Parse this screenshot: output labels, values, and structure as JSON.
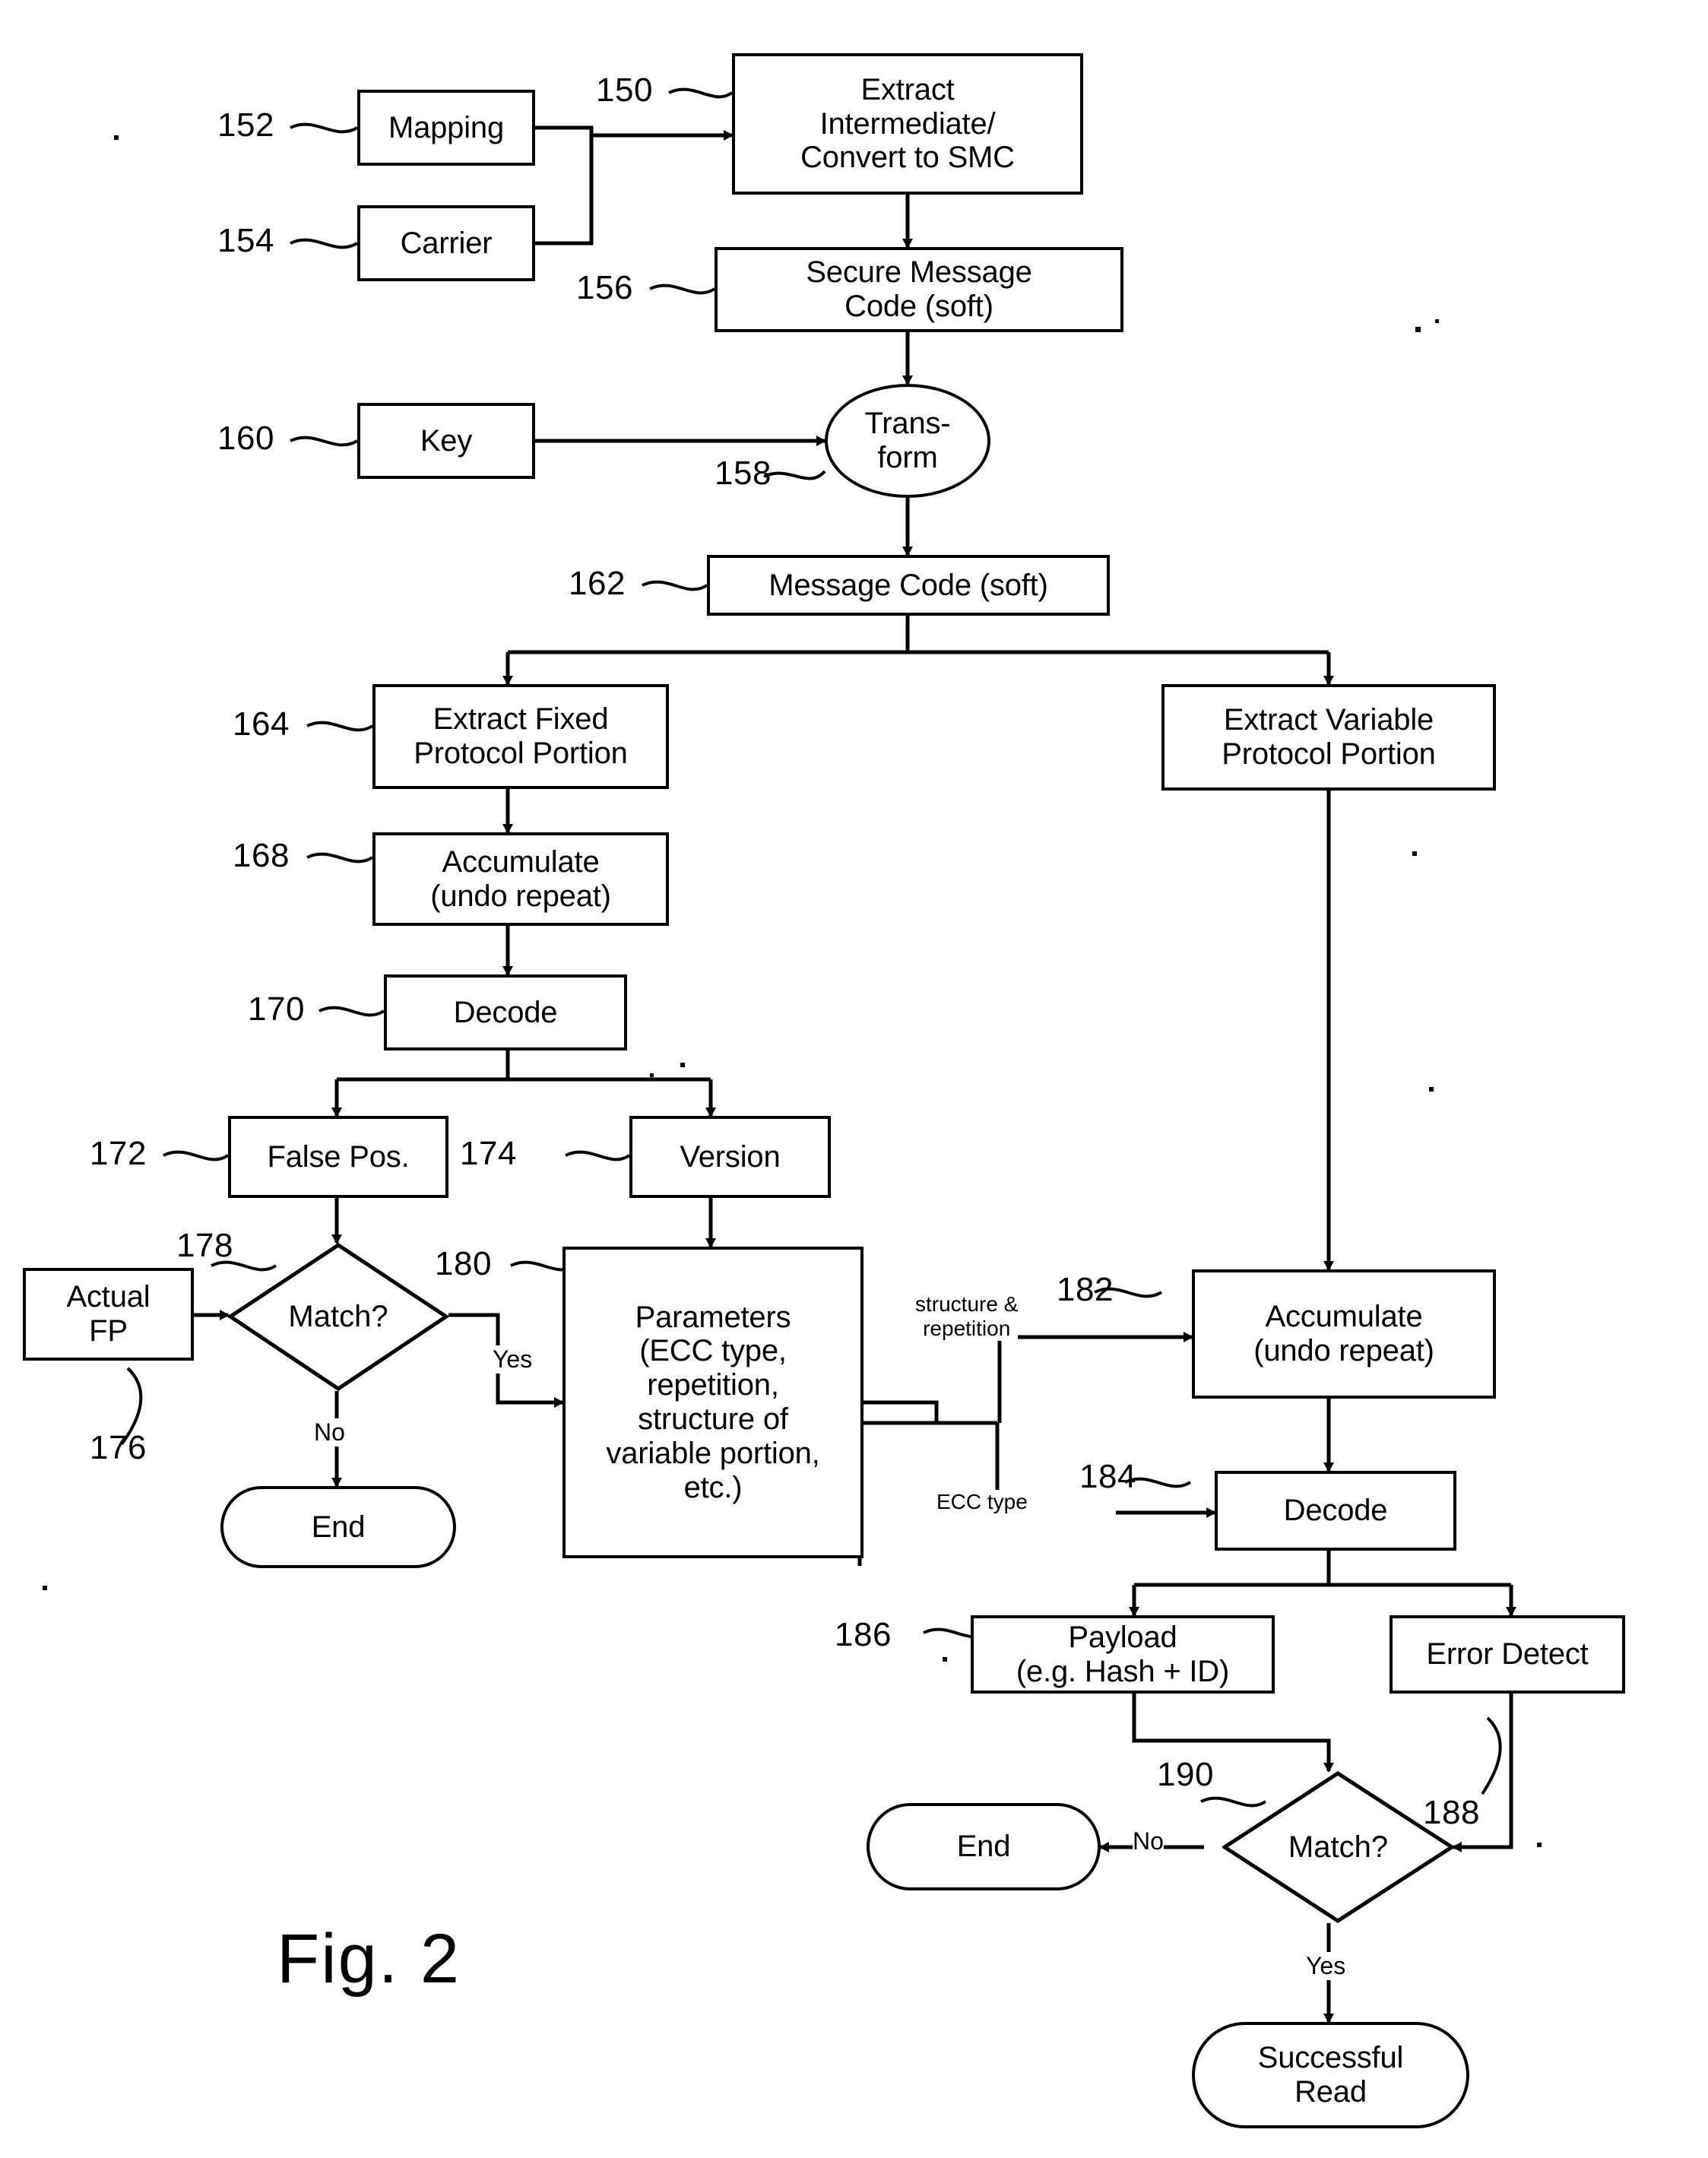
{
  "figure": {
    "caption": "Fig. 2",
    "type": "patent-flowchart"
  },
  "nodes": {
    "mapping": {
      "label": "Mapping",
      "ref": "152"
    },
    "carrier": {
      "label": "Carrier",
      "ref": "154"
    },
    "extract_intermediate": {
      "label": "Extract\nIntermediate/\nConvert to SMC",
      "ref": "150"
    },
    "secure_message_code": {
      "label": "Secure Message\nCode (soft)",
      "ref": "156"
    },
    "key": {
      "label": "Key",
      "ref": "160"
    },
    "transform": {
      "label": "Trans-\nform",
      "ref": "158"
    },
    "message_code": {
      "label": "Message Code (soft)",
      "ref": "162"
    },
    "extract_fixed": {
      "label": "Extract Fixed\nProtocol Portion",
      "ref": "164"
    },
    "extract_variable": {
      "label": "Extract Variable\nProtocol Portion",
      "ref": ""
    },
    "accumulate_fixed": {
      "label": "Accumulate\n(undo repeat)",
      "ref": "168"
    },
    "decode_fixed": {
      "label": "Decode",
      "ref": "170"
    },
    "false_pos": {
      "label": "False Pos.",
      "ref": "172"
    },
    "version": {
      "label": "Version",
      "ref": "174"
    },
    "actual_fp": {
      "label": "Actual\nFP",
      "ref": "176"
    },
    "match_fp": {
      "label": "Match?",
      "ref": "178"
    },
    "end_left": {
      "label": "End",
      "ref": ""
    },
    "parameters": {
      "label": "Parameters\n(ECC type,\nrepetition,\nstructure of\nvariable portion,\netc.)",
      "ref": "180"
    },
    "accumulate_variable": {
      "label": "Accumulate\n(undo repeat)",
      "ref": "182"
    },
    "decode_variable": {
      "label": "Decode",
      "ref": "184"
    },
    "payload": {
      "label": "Payload\n(e.g. Hash + ID)",
      "ref": "186"
    },
    "error_detect": {
      "label": "Error Detect",
      "ref": "188"
    },
    "match_payload": {
      "label": "Match?",
      "ref": "190"
    },
    "end_right": {
      "label": "End",
      "ref": ""
    },
    "successful_read": {
      "label": "Successful\nRead",
      "ref": ""
    }
  },
  "edge_labels": {
    "fp_no": "No",
    "fp_yes": "Yes",
    "structure_repetition": "structure &\nrepetition",
    "ecc_type": "ECC type",
    "payload_no": "No",
    "payload_yes": "Yes"
  },
  "colors": {
    "stroke": "#000000",
    "background": "#ffffff"
  }
}
